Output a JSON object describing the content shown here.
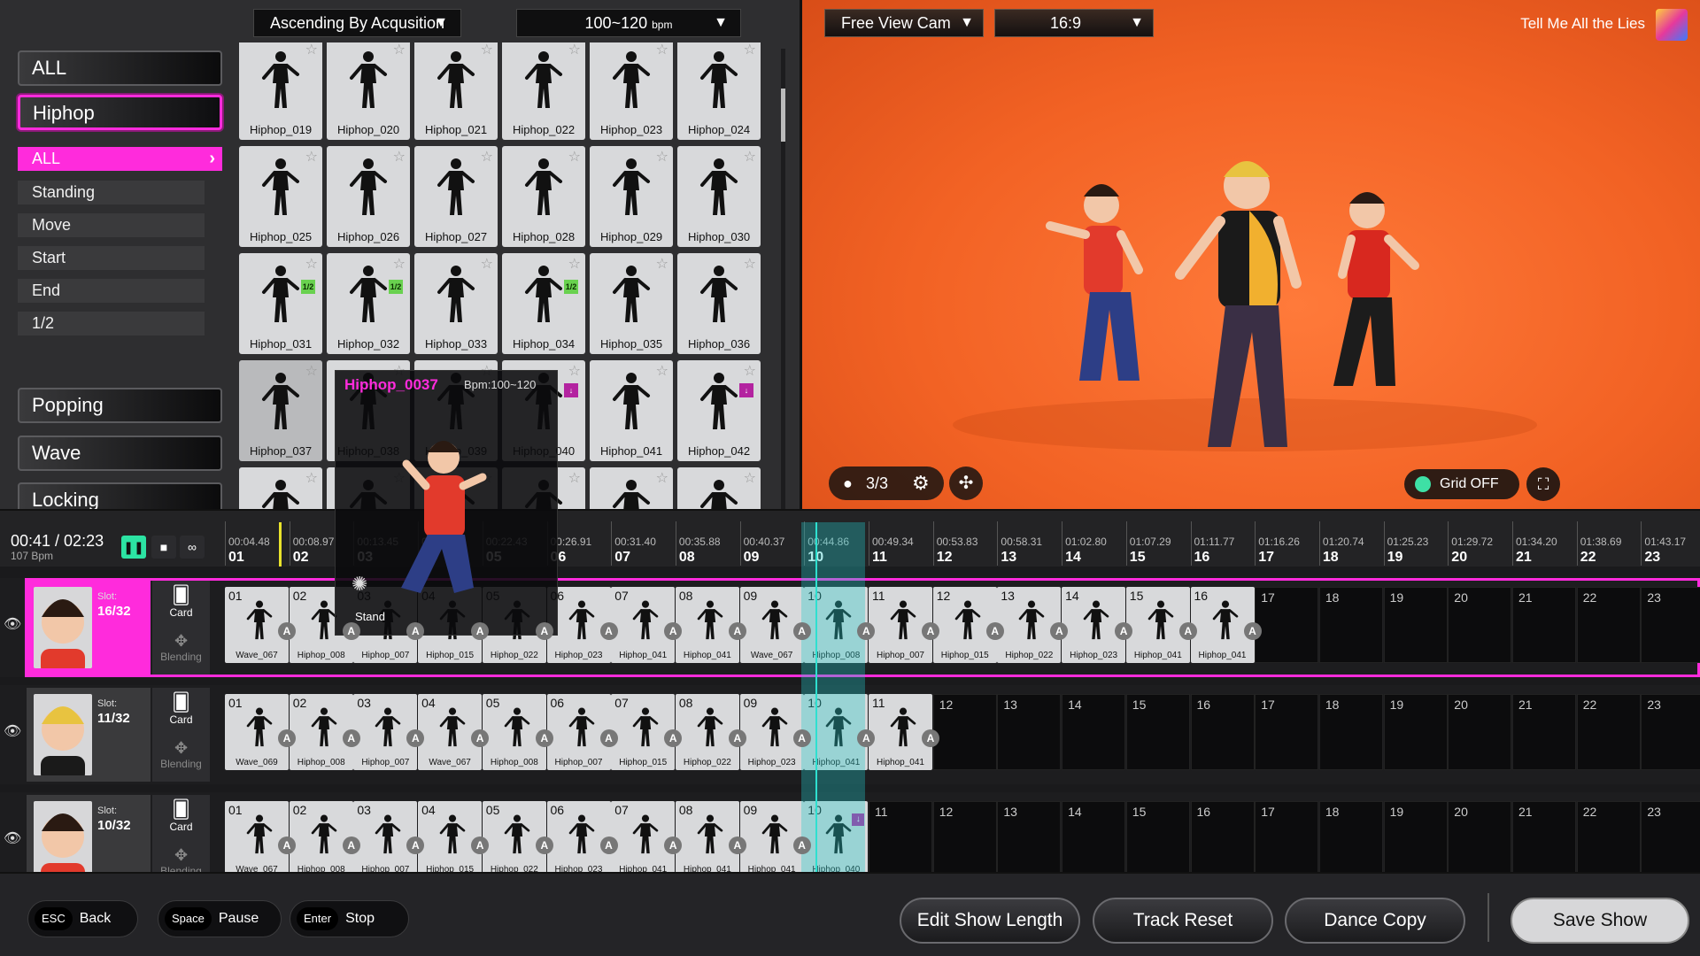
{
  "categories": {
    "main_top": [
      "ALL",
      "Hiphop"
    ],
    "active": "Hiphop",
    "sub_items": [
      "ALL",
      "Standing",
      "Move",
      "Start",
      "End",
      "1/2"
    ],
    "sub_active": "ALL",
    "main_bottom": [
      "Popping",
      "Wave",
      "Locking"
    ]
  },
  "filters": {
    "sort": "Ascending By Acqusition",
    "bpm": "100~120",
    "bpm_unit": "bpm"
  },
  "dance_grid": [
    {
      "name": "Hiphop_019"
    },
    {
      "name": "Hiphop_020"
    },
    {
      "name": "Hiphop_021"
    },
    {
      "name": "Hiphop_022"
    },
    {
      "name": "Hiphop_023"
    },
    {
      "name": "Hiphop_024"
    },
    {
      "name": "Hiphop_025"
    },
    {
      "name": "Hiphop_026"
    },
    {
      "name": "Hiphop_027"
    },
    {
      "name": "Hiphop_028"
    },
    {
      "name": "Hiphop_029"
    },
    {
      "name": "Hiphop_030"
    },
    {
      "name": "Hiphop_031",
      "badge": "1/2"
    },
    {
      "name": "Hiphop_032",
      "badge": "1/2"
    },
    {
      "name": "Hiphop_033"
    },
    {
      "name": "Hiphop_034",
      "badge": "1/2"
    },
    {
      "name": "Hiphop_035"
    },
    {
      "name": "Hiphop_036"
    },
    {
      "name": "Hiphop_037"
    },
    {
      "name": "Hiphop_038"
    },
    {
      "name": "Hiphop_039"
    },
    {
      "name": "Hiphop_040",
      "badge": "down"
    },
    {
      "name": "Hiphop_041"
    },
    {
      "name": "Hiphop_042",
      "badge": "down"
    },
    {
      "name": ""
    },
    {
      "name": ""
    },
    {
      "name": ""
    },
    {
      "name": ""
    },
    {
      "name": ""
    },
    {
      "name": ""
    }
  ],
  "preview": {
    "title": "Hiphop_0037",
    "bpm": "Bpm:100~120",
    "stance": "Stand"
  },
  "viewport": {
    "camera": "Free View Cam",
    "aspect": "16:9",
    "song": "Tell Me All the Lies",
    "count": "3/3",
    "grid": "Grid OFF"
  },
  "timeline": {
    "current": "00:41 / 02:23",
    "bpm": "107 Bpm",
    "ticks": [
      {
        "t": "00:04.48",
        "n": "01"
      },
      {
        "t": "00:08.97",
        "n": "02"
      },
      {
        "t": "00:13.45",
        "n": "03"
      },
      {
        "t": "00:17.94",
        "n": "04"
      },
      {
        "t": "00:22.43",
        "n": "05"
      },
      {
        "t": "00:26.91",
        "n": "06"
      },
      {
        "t": "00:31.40",
        "n": "07"
      },
      {
        "t": "00:35.88",
        "n": "08"
      },
      {
        "t": "00:40.37",
        "n": "09"
      },
      {
        "t": "00:44.86",
        "n": "10"
      },
      {
        "t": "00:49.34",
        "n": "11"
      },
      {
        "t": "00:53.83",
        "n": "12"
      },
      {
        "t": "00:58.31",
        "n": "13"
      },
      {
        "t": "01:02.80",
        "n": "14"
      },
      {
        "t": "01:07.29",
        "n": "15"
      },
      {
        "t": "01:11.77",
        "n": "16"
      },
      {
        "t": "01:16.26",
        "n": "17"
      },
      {
        "t": "01:20.74",
        "n": "18"
      },
      {
        "t": "01:25.23",
        "n": "19"
      },
      {
        "t": "01:29.72",
        "n": "20"
      },
      {
        "t": "01:34.20",
        "n": "21"
      },
      {
        "t": "01:38.69",
        "n": "22"
      },
      {
        "t": "01:43.17",
        "n": "23"
      }
    ]
  },
  "tracks": [
    {
      "slot_label": "Slot:",
      "slot": "16/32",
      "card": "Card",
      "blending": "Blending",
      "clips": [
        "Wave_067",
        "Hiphop_008",
        "Hiphop_007",
        "Hiphop_015",
        "Hiphop_022",
        "Hiphop_023",
        "Hiphop_041",
        "Hiphop_041",
        "Wave_067",
        "Hiphop_008",
        "Hiphop_007",
        "Hiphop_015",
        "Hiphop_022",
        "Hiphop_023",
        "Hiphop_041",
        "Hiphop_041"
      ]
    },
    {
      "slot_label": "Slot:",
      "slot": "11/32",
      "card": "Card",
      "blending": "Blending",
      "clips": [
        "Wave_069",
        "Hiphop_008",
        "Hiphop_007",
        "Wave_067",
        "Hiphop_008",
        "Hiphop_007",
        "Hiphop_015",
        "Hiphop_022",
        "Hiphop_023",
        "Hiphop_041",
        "Hiphop_041"
      ]
    },
    {
      "slot_label": "Slot:",
      "slot": "10/32",
      "card": "Card",
      "blending": "Blending",
      "clips": [
        "Wave_067",
        "Hiphop_008",
        "Hiphop_007",
        "Hiphop_015",
        "Hiphop_022",
        "Hiphop_023",
        "Hiphop_041",
        "Hiphop_041",
        "Hiphop_041",
        "Hiphop_040"
      ]
    }
  ],
  "bottom": {
    "keys": [
      {
        "k": "ESC",
        "l": "Back"
      },
      {
        "k": "Space",
        "l": "Pause"
      },
      {
        "k": "Enter",
        "l": "Stop"
      }
    ],
    "actions": [
      "Edit Show Length",
      "Track Reset",
      "Dance Copy"
    ],
    "save": "Save Show"
  },
  "colors": {
    "accent": "#ff2bdc",
    "playhead": "#2ee0d0",
    "play": "#2ce3a3",
    "stage": "#f26224"
  }
}
